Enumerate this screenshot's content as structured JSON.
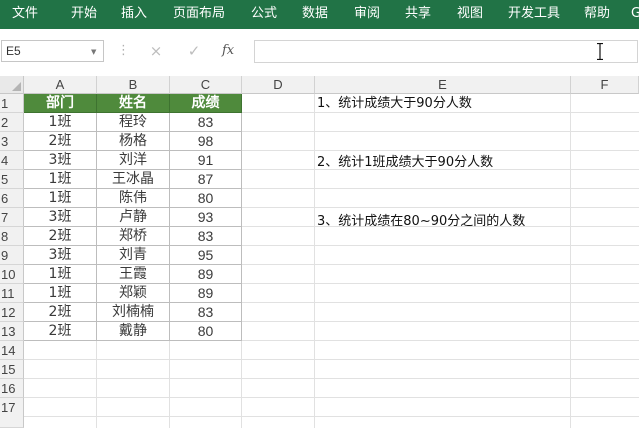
{
  "ribbon": {
    "tabs": [
      "文件",
      "开始",
      "插入",
      "页面布局",
      "公式",
      "数据",
      "审阅",
      "共享",
      "视图",
      "开发工具",
      "帮助",
      "G"
    ]
  },
  "formula_bar": {
    "name_box": "E5",
    "cancel_icon": "×",
    "enter_icon": "✓",
    "fx_label": "fx",
    "formula": ""
  },
  "sheet": {
    "columns": [
      "A",
      "B",
      "C",
      "D",
      "E",
      "F"
    ],
    "rows": [
      "1",
      "2",
      "3",
      "4",
      "5",
      "6",
      "7",
      "8",
      "9",
      "10",
      "11",
      "12",
      "13",
      "14",
      "15",
      "16",
      "17"
    ],
    "table_headers": [
      "部门",
      "姓名",
      "成绩"
    ],
    "table_rows": [
      [
        "1班",
        "程玲",
        "83"
      ],
      [
        "2班",
        "杨格",
        "98"
      ],
      [
        "3班",
        "刘洋",
        "91"
      ],
      [
        "1班",
        "王冰晶",
        "87"
      ],
      [
        "1班",
        "陈伟",
        "80"
      ],
      [
        "3班",
        "卢静",
        "93"
      ],
      [
        "2班",
        "郑桥",
        "83"
      ],
      [
        "3班",
        "刘青",
        "95"
      ],
      [
        "1班",
        "王霞",
        "89"
      ],
      [
        "1班",
        "郑颖",
        "89"
      ],
      [
        "2班",
        "刘楠楠",
        "83"
      ],
      [
        "2班",
        "戴静",
        "80"
      ]
    ],
    "notes": [
      "1、统计成绩大于90分人数",
      "2、统计1班成绩大于90分人数",
      "3、统计成绩在80~90分之间的人数"
    ]
  },
  "colors": {
    "ribbon": "#217346",
    "table_header": "#4f8a3c"
  }
}
